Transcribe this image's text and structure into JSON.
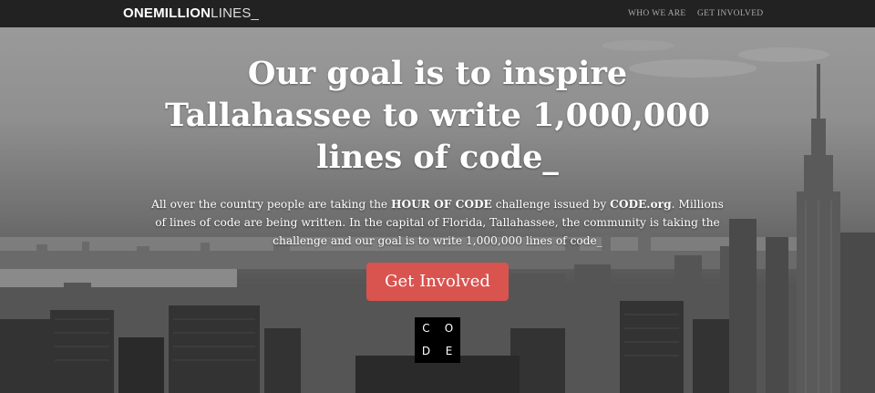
{
  "navbar": {
    "brand_bold": "ONEMILLION",
    "brand_light": "LINES_",
    "links": [
      "WHO WE ARE",
      "GET INVOLVED"
    ]
  },
  "hero": {
    "headline_lines": [
      "Our goal is to inspire",
      "Tallahassee to write 1,000,000",
      "lines of code_"
    ],
    "intro": {
      "t1": "All over the country people are taking the ",
      "b1": "HOUR OF CODE",
      "t2": " challenge issued by ",
      "b2": "CODE.org",
      "t3": ". Millions of lines of code are being written. In the capital of Florida, Tallahassee, the community is taking the challenge and our goal is to write 1,000,000 lines of code_"
    },
    "cta_label": "Get Involved",
    "code_logo_letters": [
      "C",
      "O",
      "D",
      "E"
    ]
  },
  "colors": {
    "navbar_bg": "#222222",
    "cta_bg": "#d9534f",
    "text": "#ffffff"
  }
}
